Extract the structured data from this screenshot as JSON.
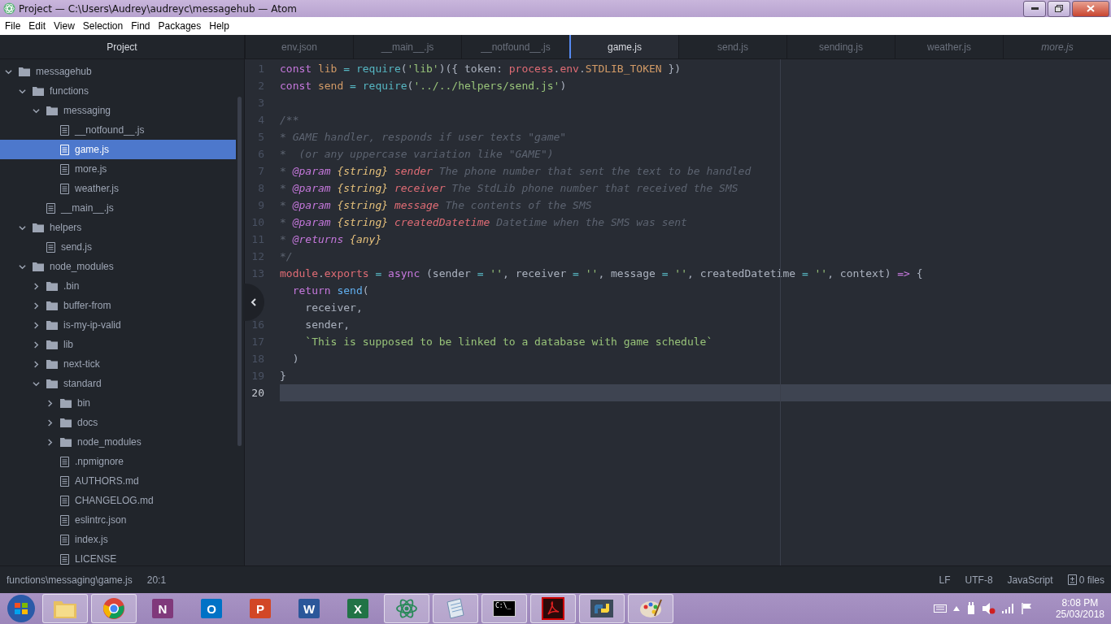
{
  "window": {
    "title": "Project — C:\\Users\\Audrey\\audreyc\\messagehub — Atom"
  },
  "menu": [
    "File",
    "Edit",
    "View",
    "Selection",
    "Find",
    "Packages",
    "Help"
  ],
  "sidebar": {
    "title": "Project",
    "tree": [
      {
        "label": "messagehub",
        "kind": "folder",
        "expanded": true,
        "selected": false,
        "children": [
          {
            "label": "functions",
            "kind": "folder",
            "expanded": true,
            "selected": false,
            "children": [
              {
                "label": "messaging",
                "kind": "folder",
                "expanded": true,
                "selected": false,
                "children": [
                  {
                    "label": "__notfound__.js",
                    "kind": "file",
                    "selected": false
                  },
                  {
                    "label": "game.js",
                    "kind": "file",
                    "selected": true
                  },
                  {
                    "label": "more.js",
                    "kind": "file",
                    "selected": false
                  },
                  {
                    "label": "weather.js",
                    "kind": "file",
                    "selected": false
                  }
                ]
              },
              {
                "label": "__main__.js",
                "kind": "file",
                "selected": false
              }
            ]
          },
          {
            "label": "helpers",
            "kind": "folder",
            "expanded": true,
            "selected": false,
            "children": [
              {
                "label": "send.js",
                "kind": "file",
                "selected": false
              }
            ]
          },
          {
            "label": "node_modules",
            "kind": "folder",
            "expanded": true,
            "selected": false,
            "children": [
              {
                "label": ".bin",
                "kind": "folder",
                "expanded": false,
                "selected": false
              },
              {
                "label": "buffer-from",
                "kind": "folder",
                "expanded": false,
                "selected": false
              },
              {
                "label": "is-my-ip-valid",
                "kind": "folder",
                "expanded": false,
                "selected": false
              },
              {
                "label": "lib",
                "kind": "folder",
                "expanded": false,
                "selected": false
              },
              {
                "label": "next-tick",
                "kind": "folder",
                "expanded": false,
                "selected": false
              },
              {
                "label": "standard",
                "kind": "folder",
                "expanded": true,
                "selected": false,
                "children": [
                  {
                    "label": "bin",
                    "kind": "folder",
                    "expanded": false,
                    "selected": false
                  },
                  {
                    "label": "docs",
                    "kind": "folder",
                    "expanded": false,
                    "selected": false
                  },
                  {
                    "label": "node_modules",
                    "kind": "folder",
                    "expanded": false,
                    "selected": false
                  },
                  {
                    "label": ".npmignore",
                    "kind": "file",
                    "selected": false
                  },
                  {
                    "label": "AUTHORS.md",
                    "kind": "file",
                    "selected": false
                  },
                  {
                    "label": "CHANGELOG.md",
                    "kind": "file",
                    "selected": false
                  },
                  {
                    "label": "eslintrc.json",
                    "kind": "file",
                    "selected": false
                  },
                  {
                    "label": "index.js",
                    "kind": "file",
                    "selected": false
                  },
                  {
                    "label": "LICENSE",
                    "kind": "file",
                    "selected": false
                  }
                ]
              }
            ]
          }
        ]
      }
    ]
  },
  "tabs": [
    {
      "label": "env.json",
      "selected": false,
      "pending": false
    },
    {
      "label": "__main__.js",
      "selected": false,
      "pending": false
    },
    {
      "label": "__notfound__.js",
      "selected": false,
      "pending": false
    },
    {
      "label": "game.js",
      "selected": true,
      "pending": false
    },
    {
      "label": "send.js",
      "selected": false,
      "pending": false
    },
    {
      "label": "sending.js",
      "selected": false,
      "pending": false
    },
    {
      "label": "weather.js",
      "selected": false,
      "pending": false
    },
    {
      "label": "more.js",
      "selected": false,
      "pending": true
    }
  ],
  "editor": {
    "lines": [
      {
        "number": "1",
        "current": false,
        "tokens": [
          {
            "kind": "keyword",
            "text": "const "
          },
          {
            "kind": "variable",
            "text": "lib"
          },
          {
            "kind": "operator",
            "text": " = "
          },
          {
            "kind": "support",
            "text": "require"
          },
          {
            "kind": "plain",
            "text": "("
          },
          {
            "kind": "string",
            "text": "'lib'"
          },
          {
            "kind": "plain",
            "text": ")({ token: "
          },
          {
            "kind": "object",
            "text": "process"
          },
          {
            "kind": "plain",
            "text": "."
          },
          {
            "kind": "object",
            "text": "env"
          },
          {
            "kind": "plain",
            "text": "."
          },
          {
            "kind": "constant",
            "text": "STDLIB_TOKEN"
          },
          {
            "kind": "plain",
            "text": " })"
          }
        ]
      },
      {
        "number": "2",
        "current": false,
        "tokens": [
          {
            "kind": "keyword",
            "text": "const "
          },
          {
            "kind": "variable",
            "text": "send"
          },
          {
            "kind": "operator",
            "text": " = "
          },
          {
            "kind": "support",
            "text": "require"
          },
          {
            "kind": "plain",
            "text": "("
          },
          {
            "kind": "string",
            "text": "'../../helpers/send.js'"
          },
          {
            "kind": "plain",
            "text": ")"
          }
        ]
      },
      {
        "number": "3",
        "current": false
      },
      {
        "number": "4",
        "current": false,
        "tokens": [
          {
            "kind": "comment",
            "text": "/**"
          }
        ]
      },
      {
        "number": "5",
        "current": false,
        "tokens": [
          {
            "kind": "comment",
            "text": "* GAME handler, responds if user texts \"game\""
          }
        ]
      },
      {
        "number": "6",
        "current": false,
        "tokens": [
          {
            "kind": "comment",
            "text": "*  (or any uppercase variation like \"GAME\")"
          }
        ]
      },
      {
        "number": "7",
        "current": false,
        "tokens": [
          {
            "kind": "comment",
            "text": "* "
          },
          {
            "kind": "tag",
            "text": "@param "
          },
          {
            "kind": "type",
            "text": "{string} "
          },
          {
            "kind": "param",
            "text": "sender"
          },
          {
            "kind": "comment",
            "text": " The phone number that sent the text to be handled"
          }
        ]
      },
      {
        "number": "8",
        "current": false,
        "tokens": [
          {
            "kind": "comment",
            "text": "* "
          },
          {
            "kind": "tag",
            "text": "@param "
          },
          {
            "kind": "type",
            "text": "{string} "
          },
          {
            "kind": "param",
            "text": "receiver"
          },
          {
            "kind": "comment",
            "text": " The StdLib phone number that received the SMS"
          }
        ]
      },
      {
        "number": "9",
        "current": false,
        "tokens": [
          {
            "kind": "comment",
            "text": "* "
          },
          {
            "kind": "tag",
            "text": "@param "
          },
          {
            "kind": "type",
            "text": "{string} "
          },
          {
            "kind": "param",
            "text": "message"
          },
          {
            "kind": "comment",
            "text": " The contents of the SMS"
          }
        ]
      },
      {
        "number": "10",
        "current": false,
        "tokens": [
          {
            "kind": "comment",
            "text": "* "
          },
          {
            "kind": "tag",
            "text": "@param "
          },
          {
            "kind": "type",
            "text": "{string} "
          },
          {
            "kind": "param",
            "text": "createdDatetime"
          },
          {
            "kind": "comment",
            "text": " Datetime when the SMS was sent"
          }
        ]
      },
      {
        "number": "11",
        "current": false,
        "tokens": [
          {
            "kind": "comment",
            "text": "* "
          },
          {
            "kind": "tag",
            "text": "@returns "
          },
          {
            "kind": "type",
            "text": "{any}"
          }
        ]
      },
      {
        "number": "12",
        "current": false,
        "tokens": [
          {
            "kind": "comment",
            "text": "*/"
          }
        ]
      },
      {
        "number": "13",
        "current": false,
        "tokens": [
          {
            "kind": "object",
            "text": "module"
          },
          {
            "kind": "plain",
            "text": "."
          },
          {
            "kind": "object",
            "text": "exports"
          },
          {
            "kind": "operator",
            "text": " = "
          },
          {
            "kind": "keyword",
            "text": "async"
          },
          {
            "kind": "plain",
            "text": " (sender "
          },
          {
            "kind": "operator",
            "text": "= "
          },
          {
            "kind": "string",
            "text": "''"
          },
          {
            "kind": "plain",
            "text": ", receiver "
          },
          {
            "kind": "operator",
            "text": "= "
          },
          {
            "kind": "string",
            "text": "''"
          },
          {
            "kind": "plain",
            "text": ", message "
          },
          {
            "kind": "operator",
            "text": "= "
          },
          {
            "kind": "string",
            "text": "''"
          },
          {
            "kind": "plain",
            "text": ", createdDatetime "
          },
          {
            "kind": "operator",
            "text": "= "
          },
          {
            "kind": "string",
            "text": "''"
          },
          {
            "kind": "plain",
            "text": ", context) "
          },
          {
            "kind": "keyword",
            "text": "=> "
          },
          {
            "kind": "plain",
            "text": "{"
          }
        ]
      },
      {
        "current": false,
        "tokens": [
          {
            "kind": "keyword",
            "text": "  return "
          },
          {
            "kind": "function",
            "text": "send"
          },
          {
            "kind": "plain",
            "text": "("
          }
        ]
      },
      {
        "current": false,
        "tokens": [
          {
            "kind": "plain",
            "text": "    receiver,"
          }
        ]
      },
      {
        "number": "16",
        "current": false,
        "tokens": [
          {
            "kind": "plain",
            "text": "    sender,"
          }
        ]
      },
      {
        "number": "17",
        "current": false,
        "tokens": [
          {
            "kind": "string",
            "text": "    `This is supposed to be linked to a database with game schedule`"
          }
        ]
      },
      {
        "number": "18",
        "current": false,
        "tokens": [
          {
            "kind": "plain",
            "text": "  )"
          }
        ]
      },
      {
        "number": "19",
        "current": false,
        "tokens": [
          {
            "kind": "plain",
            "text": "}"
          }
        ]
      },
      {
        "number": "20",
        "current": true
      }
    ]
  },
  "status_bar": {
    "left": [
      "functions\\messaging\\game.js",
      "20:1"
    ],
    "right": [
      "LF",
      "UTF-8",
      "JavaScript"
    ],
    "files": "0 files"
  },
  "taskbar": {
    "apps": [
      {
        "kind": "folder",
        "open": true
      },
      {
        "kind": "browser",
        "open": true
      },
      {
        "kind": "tile",
        "glyph": "N",
        "color": "#80397b",
        "open": false
      },
      {
        "kind": "tile",
        "glyph": "O",
        "color": "#0072c6",
        "open": false
      },
      {
        "kind": "tile",
        "glyph": "P",
        "color": "#d24726",
        "open": false
      },
      {
        "kind": "tile",
        "glyph": "W",
        "color": "#2b579a",
        "open": false
      },
      {
        "kind": "tile",
        "glyph": "X",
        "color": "#217346",
        "open": false
      },
      {
        "kind": "atom",
        "open": true
      },
      {
        "kind": "notepad",
        "open": true
      },
      {
        "kind": "terminal",
        "glyph": "C:\\_",
        "open": true
      },
      {
        "kind": "pdf",
        "open": true
      },
      {
        "kind": "python",
        "open": true
      },
      {
        "kind": "paint",
        "open": true
      }
    ],
    "time": "8:08 PM",
    "date": "25/03/2018"
  }
}
